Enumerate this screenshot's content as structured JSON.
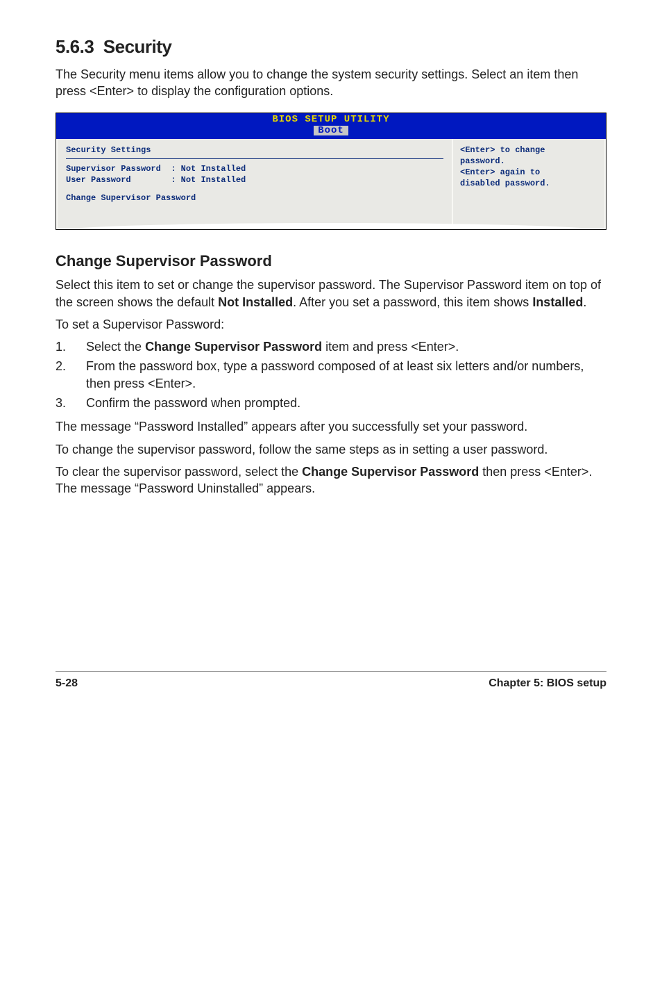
{
  "section": {
    "number": "5.6.3",
    "title": "Security"
  },
  "intro": "The Security menu items allow you to change the system security settings. Select an item then press <Enter> to display the configuration options.",
  "bios": {
    "header_title": "BIOS SETUP UTILITY",
    "header_tab": "Boot",
    "left": {
      "title": "Security Settings",
      "row1_label": "Supervisor Password",
      "row1_value": ": Not Installed",
      "row2_label": "User Password",
      "row2_value": ": Not Installed",
      "row3": "Change Supervisor Password"
    },
    "right": {
      "line1": "<Enter> to change",
      "line2": "password.",
      "line3": "<Enter> again to",
      "line4": "disabled password."
    }
  },
  "subheading": "Change Supervisor Password",
  "para1_a": "Select this item to set or change the supervisor password. The Supervisor Password item on top of the screen shows the default ",
  "para1_b": "Not Installed",
  "para1_c": ". After you set a password, this item shows ",
  "para1_d": "Installed",
  "para1_e": ".",
  "para2": "To set a Supervisor Password:",
  "steps": {
    "s1_a": "Select the ",
    "s1_b": "Change Supervisor Password",
    "s1_c": " item and press <Enter>.",
    "s2": "From the password box, type a password composed of at least six letters and/or numbers, then press <Enter>.",
    "s3": "Confirm the password when prompted."
  },
  "para3": "The message “Password Installed” appears after you successfully set your password.",
  "para4": "To change the supervisor password, follow the same steps as in setting a user password.",
  "para5_a": "To clear the supervisor password, select the ",
  "para5_b": "Change Supervisor Password",
  "para5_c": " then press <Enter>. The message “Password Uninstalled” appears.",
  "footer": {
    "left": "5-28",
    "right": "Chapter 5: BIOS setup"
  }
}
